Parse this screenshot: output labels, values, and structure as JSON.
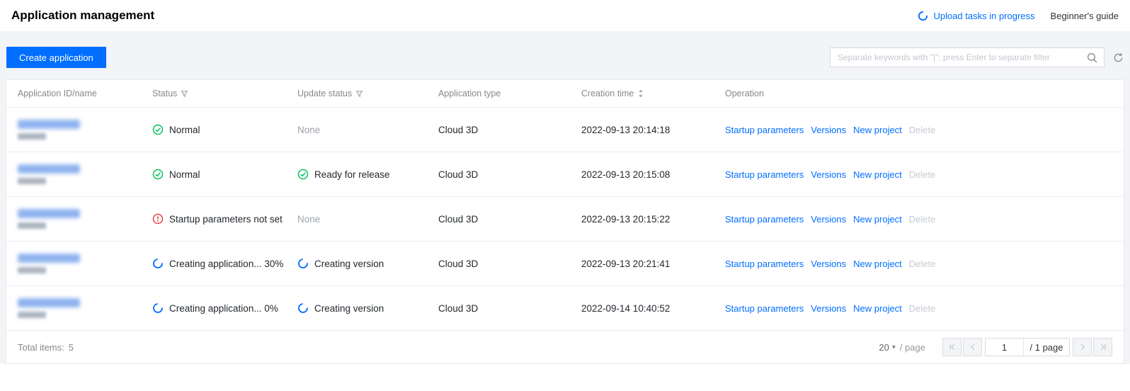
{
  "header": {
    "title": "Application management",
    "upload_tasks_label": "Upload tasks in progress",
    "guide_label": "Beginner's guide"
  },
  "toolbar": {
    "create_button": "Create application",
    "search_placeholder": "Separate keywords with \"|\"; press Enter to separate filter"
  },
  "table": {
    "columns": [
      "Application ID/name",
      "Status",
      "Update status",
      "Application type",
      "Creation time",
      "Operation"
    ],
    "operations": [
      "Startup parameters",
      "Versions",
      "New project"
    ],
    "delete_label": "Delete",
    "rows": [
      {
        "status": "Normal",
        "status_type": "success",
        "update_status": "None",
        "update_type": "none",
        "app_type": "Cloud 3D",
        "creation_time": "2022-09-13 20:14:18"
      },
      {
        "status": "Normal",
        "status_type": "success",
        "update_status": "Ready for release",
        "update_type": "success",
        "app_type": "Cloud 3D",
        "creation_time": "2022-09-13 20:15:08"
      },
      {
        "status": "Startup parameters not set",
        "status_type": "error",
        "update_status": "None",
        "update_type": "none",
        "app_type": "Cloud 3D",
        "creation_time": "2022-09-13 20:15:22"
      },
      {
        "status": "Creating application... 30%",
        "status_type": "loading",
        "update_status": "Creating version",
        "update_type": "loading",
        "app_type": "Cloud 3D",
        "creation_time": "2022-09-13 20:21:41"
      },
      {
        "status": "Creating application... 0%",
        "status_type": "loading",
        "update_status": "Creating version",
        "update_type": "loading",
        "app_type": "Cloud 3D",
        "creation_time": "2022-09-14 10:40:52"
      }
    ]
  },
  "footer": {
    "total_label": "Total items:",
    "total_value": "5",
    "page_size": "20",
    "per_page_label": "/ page",
    "page_input": "1",
    "page_total_label": "/ 1 page"
  },
  "colors": {
    "accent": "#006eff",
    "success": "#0abf5b",
    "error": "#e54545",
    "muted": "#9da3ac"
  }
}
